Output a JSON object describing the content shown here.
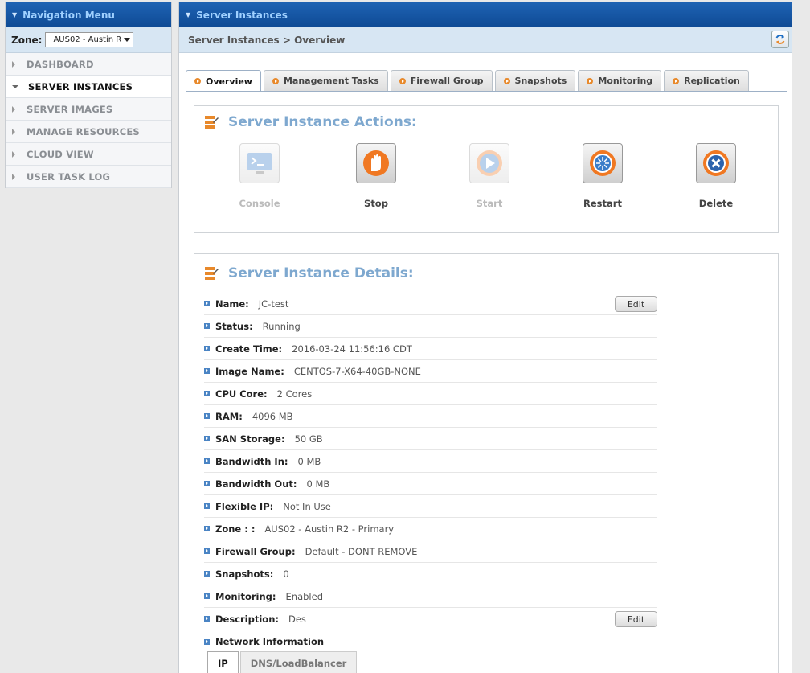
{
  "nav": {
    "title": "Navigation Menu",
    "zone_label": "Zone:",
    "zone_value": "AUS02 - Austin R",
    "items": [
      {
        "label": "DASHBOARD",
        "active": false
      },
      {
        "label": "SERVER INSTANCES",
        "active": true
      },
      {
        "label": "SERVER IMAGES",
        "active": false
      },
      {
        "label": "MANAGE RESOURCES",
        "active": false
      },
      {
        "label": "CLOUD VIEW",
        "active": false
      },
      {
        "label": "USER TASK LOG",
        "active": false
      }
    ]
  },
  "main": {
    "title": "Server Instances",
    "breadcrumb": "Server Instances >  Overview",
    "tabs": [
      "Overview",
      "Management Tasks",
      "Firewall Group",
      "Snapshots",
      "Monitoring",
      "Replication"
    ],
    "active_tab": "Overview"
  },
  "actions": {
    "title": "Server Instance Actions:",
    "items": [
      {
        "label": "Console",
        "enabled": false,
        "icon": "console-icon"
      },
      {
        "label": "Stop",
        "enabled": true,
        "icon": "stop-hand-icon"
      },
      {
        "label": "Start",
        "enabled": false,
        "icon": "play-icon"
      },
      {
        "label": "Restart",
        "enabled": true,
        "icon": "restart-icon"
      },
      {
        "label": "Delete",
        "enabled": true,
        "icon": "delete-x-icon"
      }
    ]
  },
  "details": {
    "title": "Server Instance Details:",
    "edit_label": "Edit",
    "rows": [
      {
        "key": "Name:",
        "value": "JC-test",
        "editable": true
      },
      {
        "key": "Status:",
        "value": "Running"
      },
      {
        "key": "Create Time:",
        "value": "2016-03-24 11:56:16 CDT"
      },
      {
        "key": "Image Name:",
        "value": "CENTOS-7-X64-40GB-NONE"
      },
      {
        "key": "CPU Core:",
        "value": "2 Cores"
      },
      {
        "key": "RAM:",
        "value": "4096 MB"
      },
      {
        "key": "SAN Storage:",
        "value": "50 GB"
      },
      {
        "key": "Bandwidth In:",
        "value": "0 MB"
      },
      {
        "key": "Bandwidth Out:",
        "value": "0 MB"
      },
      {
        "key": "Flexible IP:",
        "value": "Not In Use"
      },
      {
        "key": "Zone : :",
        "value": "AUS02 - Austin R2 - Primary"
      },
      {
        "key": "Firewall Group:",
        "value": "Default - DONT REMOVE"
      },
      {
        "key": "Snapshots:",
        "value": "0"
      },
      {
        "key": "Monitoring:",
        "value": "Enabled"
      },
      {
        "key": "Description:",
        "value": "Des",
        "editable": true
      },
      {
        "key": "Network Information",
        "value": ""
      }
    ],
    "network_tabs": [
      "IP",
      "DNS/LoadBalancer"
    ]
  },
  "colors": {
    "header_blue": "#0e4a95",
    "accent_orange": "#e8892b",
    "section_title": "#7ea8cf"
  }
}
